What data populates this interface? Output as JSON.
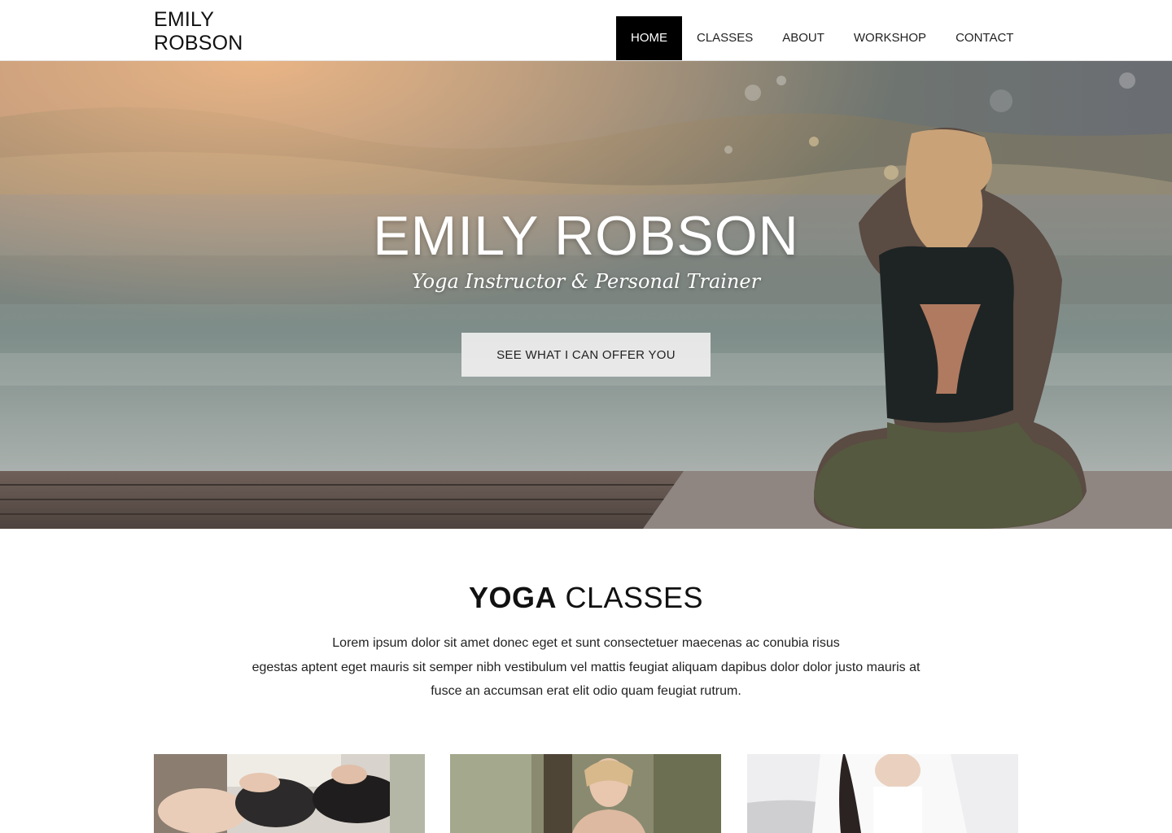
{
  "header": {
    "logo_line1": "EMILY",
    "logo_line2": "ROBSON",
    "nav": [
      {
        "label": "HOME",
        "active": true
      },
      {
        "label": "CLASSES"
      },
      {
        "label": "ABOUT"
      },
      {
        "label": "WORKSHOP"
      },
      {
        "label": "CONTACT"
      }
    ]
  },
  "hero": {
    "title": "EMILY ROBSON",
    "subtitle": "Yoga Instructor & Personal Trainer",
    "cta_label": "SEE WHAT I CAN OFFER YOU"
  },
  "classes": {
    "title_bold": "YOGA",
    "title_rest": " CLASSES",
    "text_lines": [
      "Lorem ipsum dolor sit amet donec eget et sunt consectetuer maecenas ac conubia risus",
      "egestas aptent eget mauris sit semper nibh vestibulum vel mattis feugiat aliquam dapibus dolor dolor justo mauris at",
      "fusce an accumsan erat elit odio quam feugiat rutrum."
    ]
  },
  "colors": {
    "nav_active_bg": "#000000",
    "page_bg": "#ffffff"
  }
}
